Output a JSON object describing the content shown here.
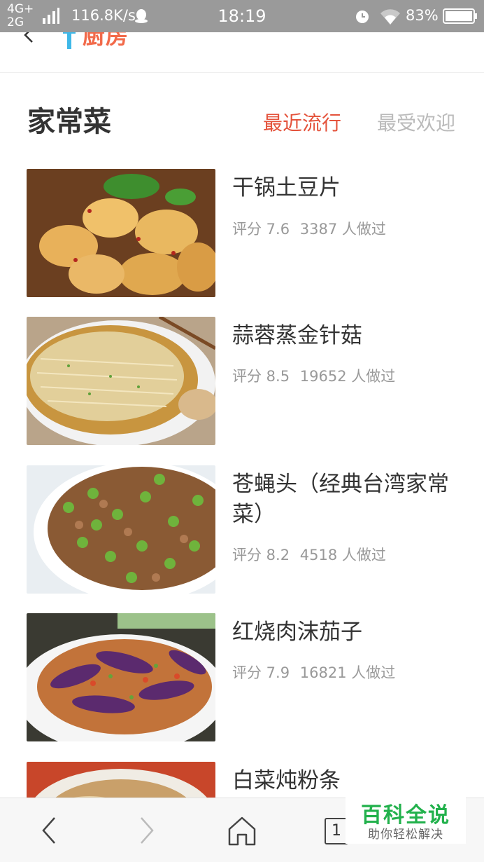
{
  "status_bar": {
    "network_top": "4G+",
    "network_bottom": "2G",
    "speed": "116.8K/s",
    "time": "18:19",
    "battery": "83%"
  },
  "header": {
    "logo_text": "厨房",
    "back_icon": "chevron-left-icon"
  },
  "section": {
    "title": "家常菜",
    "tabs": [
      {
        "label": "最近流行",
        "active": true
      },
      {
        "label": "最受欢迎",
        "active": false
      }
    ]
  },
  "recipes": [
    {
      "name": "干锅土豆片",
      "score": "评分 7.6",
      "count": "3387 人做过"
    },
    {
      "name": "蒜蓉蒸金针菇",
      "score": "评分 8.5",
      "count": "19652 人做过"
    },
    {
      "name": "苍蝇头（经典台湾家常菜）",
      "score": "评分 8.2",
      "count": "4518 人做过"
    },
    {
      "name": "红烧肉沫茄子",
      "score": "评分 7.9",
      "count": "16821 人做过"
    },
    {
      "name": "白菜炖粉条",
      "score": "",
      "count": ""
    }
  ],
  "bottom_nav": {
    "tab_count": "1",
    "icons": [
      "back-arrow-icon",
      "forward-arrow-icon",
      "home-icon",
      "tabs-icon"
    ]
  },
  "watermark": {
    "title": "百科全说",
    "subtitle": "助你轻松解决"
  },
  "colors": {
    "accent": "#e4533c",
    "inactive_tab": "#bbbbbb",
    "status_bar": "#9a9a9a",
    "watermark_green": "#22b14c"
  }
}
